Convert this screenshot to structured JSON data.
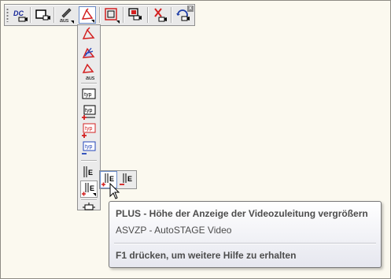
{
  "toolbar": {
    "buttons": [
      {
        "icon": "dc-icon",
        "label": "DC"
      },
      {
        "icon": "video-frame-icon"
      },
      {
        "icon": "pen-aus-icon",
        "label": "aus"
      },
      {
        "icon": "red-draw-icon"
      },
      {
        "icon": "red-box-icon"
      },
      {
        "icon": "record-icon"
      },
      {
        "icon": "red-x-icon"
      },
      {
        "icon": "rotate-icon"
      }
    ],
    "close_label": "x"
  },
  "dropdown": {
    "aus_label": "aus",
    "typ_label": "typ",
    "e_label": "E"
  },
  "tooltip": {
    "title": "PLUS - Höhe der Anzeige der Videozuleitung vergrößern",
    "subtitle": "ASVZP - AutoSTAGE Video",
    "help": "F1 drücken, um weitere Hilfe zu erhalten"
  },
  "colors": {
    "accent": "#d32020",
    "blue": "#2345b8",
    "tooltip_text": "#4c4c4c"
  }
}
